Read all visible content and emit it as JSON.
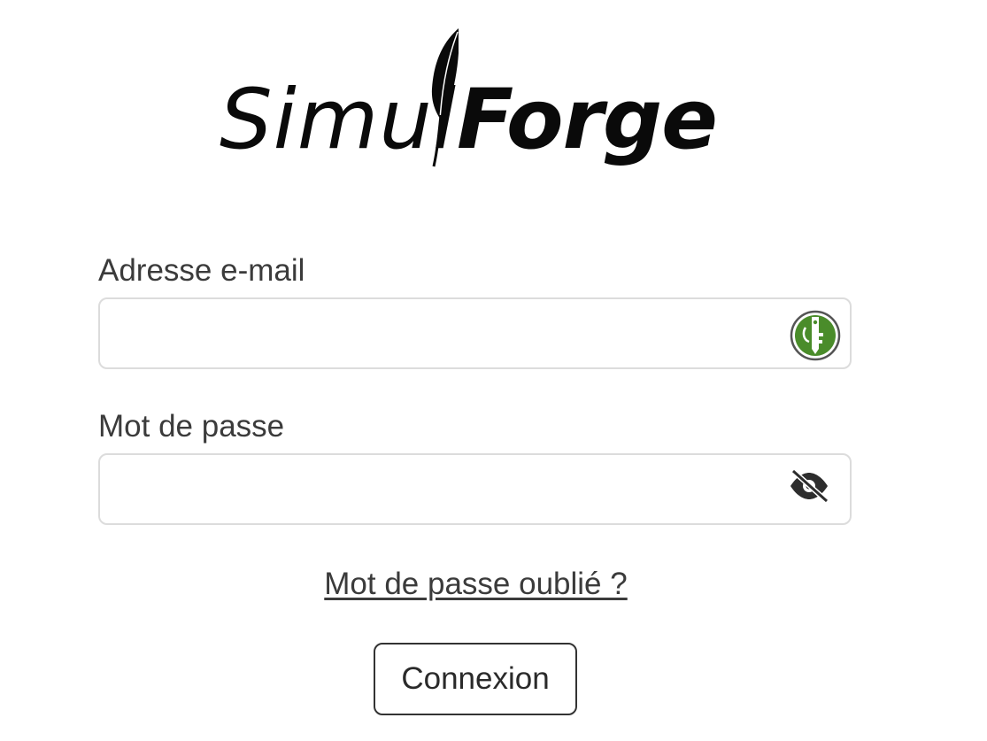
{
  "logo": {
    "text_light": "Simul",
    "text_bold": "Forge",
    "icon": "quill-icon"
  },
  "form": {
    "email": {
      "label": "Adresse e-mail",
      "value": "",
      "placeholder": "",
      "icon": "keepassxc-key-icon",
      "icon_color": "#4a8c2a"
    },
    "password": {
      "label": "Mot de passe",
      "value": "",
      "placeholder": "",
      "icon": "eye-slash-icon"
    },
    "forgot_link": "Mot de passe oublié ?",
    "submit_label": "Connexion"
  }
}
